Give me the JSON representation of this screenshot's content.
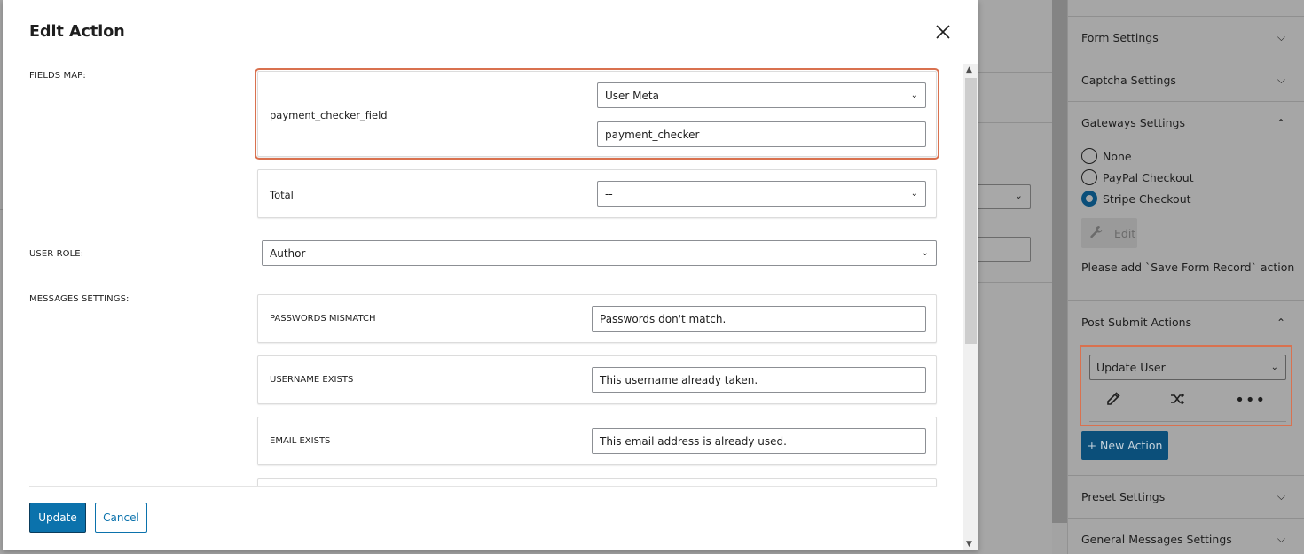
{
  "background": {
    "visible_select_chevron": "⌄"
  },
  "sidebar": {
    "panels_top": [
      {
        "label": "Form Settings",
        "expanded": false
      },
      {
        "label": "Captcha Settings",
        "expanded": false
      },
      {
        "label": "Gateways Settings",
        "expanded": true
      }
    ],
    "gateways": {
      "options": [
        {
          "label": "None",
          "checked": false
        },
        {
          "label": "PayPal Checkout",
          "checked": false
        },
        {
          "label": "Stripe Checkout",
          "checked": true
        }
      ],
      "edit_label": "Edit",
      "note": "Please add `Save Form Record` action"
    },
    "post_submit": {
      "title": "Post Submit Actions",
      "expanded": true,
      "selected_action": "Update User",
      "new_action_label": "+ New Action",
      "icons": [
        "edit-pencil-icon",
        "shuffle-icon",
        "more-dots-icon"
      ]
    },
    "panels_bottom": [
      {
        "label": "Preset Settings",
        "expanded": false
      },
      {
        "label": "General Messages Settings",
        "expanded": false
      }
    ]
  },
  "modal": {
    "title": "Edit Action",
    "fields_map": {
      "label": "FIELDS MAP:",
      "rows": [
        {
          "field": "payment_checker_field",
          "type": "User Meta",
          "meta_key": "payment_checker",
          "highlighted": true
        },
        {
          "field": "Total",
          "type": "--"
        }
      ]
    },
    "user_role": {
      "label": "USER ROLE:",
      "value": "Author"
    },
    "messages": {
      "label": "MESSAGES SETTINGS:",
      "items": [
        {
          "key": "PASSWORDS MISMATCH",
          "value": "Passwords don't match."
        },
        {
          "key": "USERNAME EXISTS",
          "value": "This username already taken."
        },
        {
          "key": "EMAIL EXISTS",
          "value": "This email address is already used."
        }
      ]
    },
    "buttons": {
      "update": "Update",
      "cancel": "Cancel"
    }
  },
  "colors": {
    "primary": "#0b72ac",
    "highlight": "#d9714f",
    "overlay": "#a6a6a6"
  }
}
